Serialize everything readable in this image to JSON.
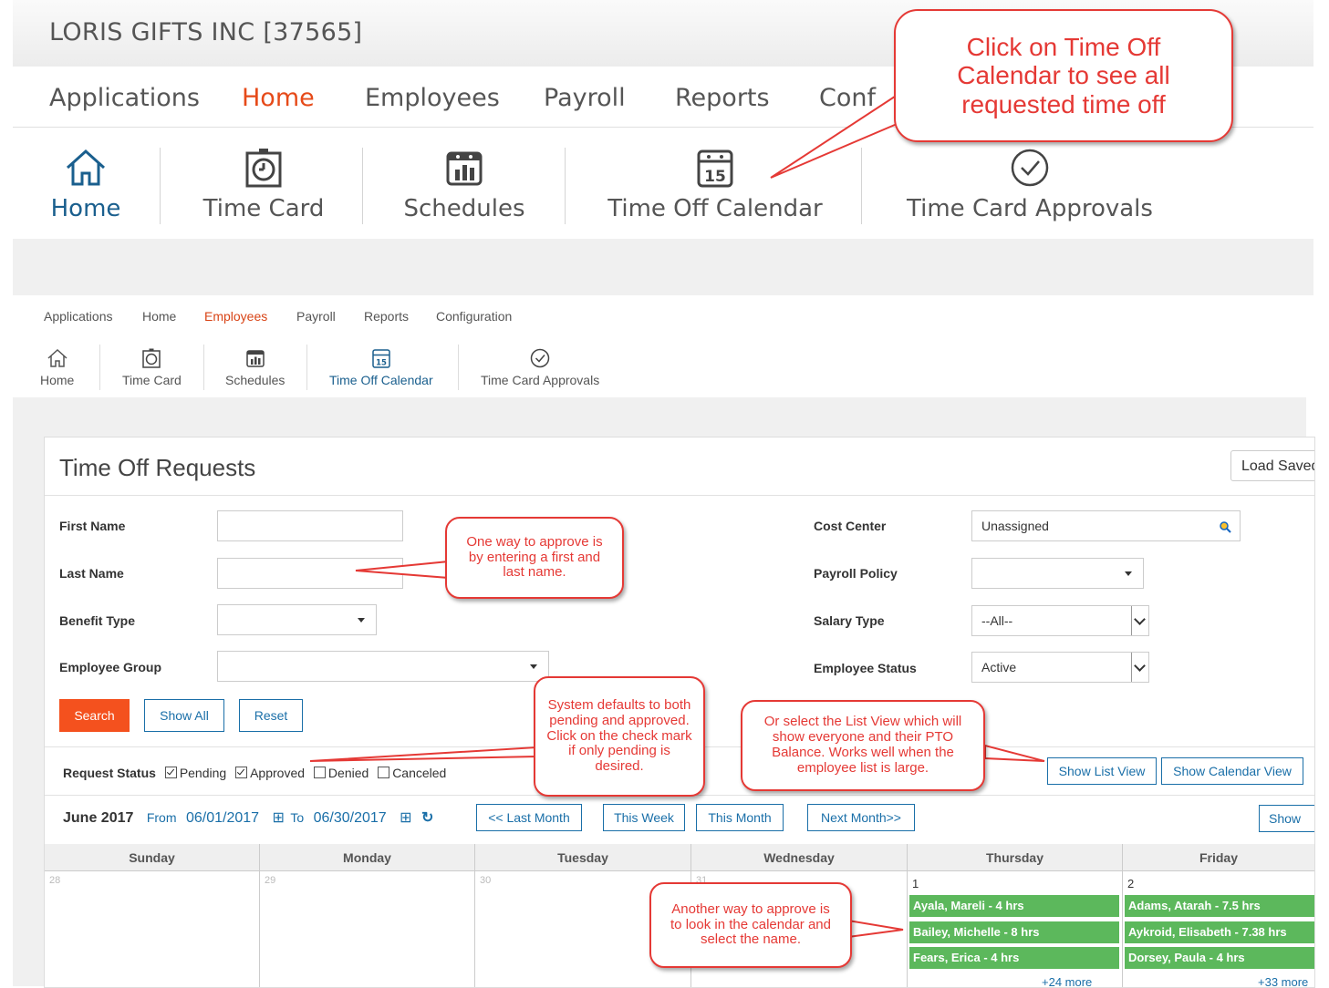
{
  "company": "LORIS GIFTS INC [37565]",
  "nav": [
    "Applications",
    "Home",
    "Employees",
    "Payroll",
    "Reports",
    "Configuration"
  ],
  "top_nav": [
    "Applications",
    "Home",
    "Employees",
    "Payroll",
    "Reports",
    "Conf"
  ],
  "modules": [
    "Home",
    "Time Card",
    "Schedules",
    "Time Off Calendar",
    "Time Card Approvals"
  ],
  "panel": {
    "title": "Time Off Requests",
    "load_saved": "Load Saved"
  },
  "filters": {
    "first_name": {
      "label": "First Name",
      "value": ""
    },
    "last_name": {
      "label": "Last Name",
      "value": ""
    },
    "benefit_type": {
      "label": "Benefit Type",
      "value": ""
    },
    "employee_group": {
      "label": "Employee Group",
      "value": ""
    },
    "cost_center": {
      "label": "Cost Center",
      "value": "Unassigned"
    },
    "payroll_policy": {
      "label": "Payroll Policy",
      "value": ""
    },
    "salary_type": {
      "label": "Salary Type",
      "value": "--All--"
    },
    "employee_status": {
      "label": "Employee Status",
      "value": "Active"
    }
  },
  "buttons": {
    "search": "Search",
    "show_all": "Show All",
    "reset": "Reset",
    "list_view": "Show List View",
    "calendar_view": "Show Calendar View",
    "last_month": "<< Last Month",
    "this_week": "This Week",
    "this_month": "This Month",
    "next_month": "Next Month>>",
    "show": "Show"
  },
  "request_status": {
    "label": "Request Status",
    "options": [
      {
        "label": "Pending",
        "checked": true
      },
      {
        "label": "Approved",
        "checked": true
      },
      {
        "label": "Denied",
        "checked": false
      },
      {
        "label": "Canceled",
        "checked": false
      }
    ]
  },
  "range": {
    "month": "June 2017",
    "from_label": "From",
    "from": "06/01/2017",
    "to_label": "To",
    "to": "06/30/2017"
  },
  "calendar": {
    "days": [
      "Sunday",
      "Monday",
      "Tuesday",
      "Wednesday",
      "Thursday",
      "Friday"
    ],
    "dates": [
      "28",
      "29",
      "30",
      "31",
      "1",
      "2"
    ],
    "thursday_events": [
      "Ayala, Mareli - 4 hrs",
      "Bailey, Michelle - 8 hrs",
      "Fears, Erica - 4 hrs"
    ],
    "thursday_more": "+24 more",
    "friday_events": [
      "Adams, Atarah - 7.5 hrs",
      "Aykroid, Elisabeth - 7.38 hrs",
      "Dorsey, Paula - 4 hrs"
    ],
    "friday_more": "+33 more"
  },
  "callouts": {
    "time_off": "Click on Time Off Calendar to see all requested time off",
    "name": "One way to approve is by entering a first and last name.",
    "status": "System defaults to both pending and approved.  Click on the check mark if only pending is desired.",
    "list_view": "Or select the List View which will show everyone and their PTO Balance.  Works well when the employee list is large.",
    "calendar": "Another way to approve is to look in the calendar and select the name."
  },
  "colors": {
    "accent": "#f4511e",
    "link": "#1a6fa8",
    "event": "#5cb85c",
    "callout": "#e53935"
  }
}
